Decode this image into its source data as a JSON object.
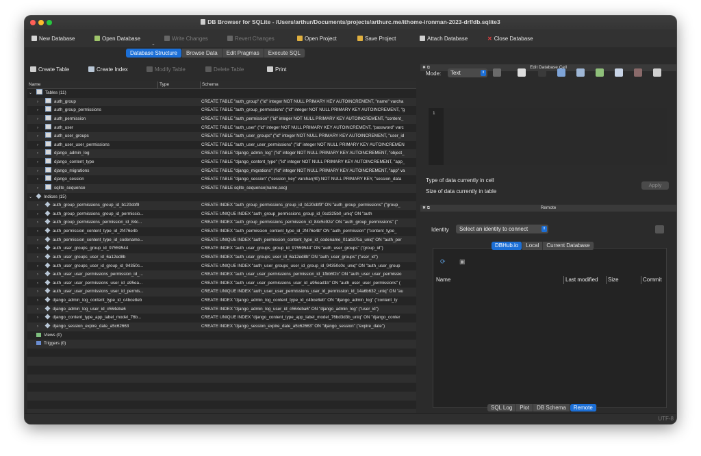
{
  "window": {
    "title": "DB Browser for SQLite - /Users/arthur/Documents/projects/arthurc.me/ithome-ironman-2023-drf/db.sqlite3"
  },
  "toolbar": {
    "new_database": "New Database",
    "open_database": "Open Database",
    "write_changes": "Write Changes",
    "revert_changes": "Revert Changes",
    "open_project": "Open Project",
    "save_project": "Save Project",
    "attach_database": "Attach Database",
    "close_database": "Close Database"
  },
  "tabs": [
    "Database Structure",
    "Browse Data",
    "Edit Pragmas",
    "Execute SQL"
  ],
  "structure_toolbar": {
    "create_table": "Create Table",
    "create_index": "Create Index",
    "modify_table": "Modify Table",
    "delete_table": "Delete Table",
    "print": "Print"
  },
  "tree": {
    "columns": {
      "name": "Name",
      "type": "Type",
      "schema": "Schema"
    },
    "tables_header": "Tables (11)",
    "tables": [
      {
        "name": "auth_group",
        "schema": "CREATE TABLE \"auth_group\" (\"id\" integer NOT NULL PRIMARY KEY AUTOINCREMENT, \"name\" varcha"
      },
      {
        "name": "auth_group_permissions",
        "schema": "CREATE TABLE \"auth_group_permissions\" (\"id\" integer NOT NULL PRIMARY KEY AUTOINCREMENT, \"g"
      },
      {
        "name": "auth_permission",
        "schema": "CREATE TABLE \"auth_permission\" (\"id\" integer NOT NULL PRIMARY KEY AUTOINCREMENT, \"content_"
      },
      {
        "name": "auth_user",
        "schema": "CREATE TABLE \"auth_user\" (\"id\" integer NOT NULL PRIMARY KEY AUTOINCREMENT, \"password\" varc"
      },
      {
        "name": "auth_user_groups",
        "schema": "CREATE TABLE \"auth_user_groups\" (\"id\" integer NOT NULL PRIMARY KEY AUTOINCREMENT, \"user_id"
      },
      {
        "name": "auth_user_user_permissions",
        "schema": "CREATE TABLE \"auth_user_user_permissions\" (\"id\" integer NOT NULL PRIMARY KEY AUTOINCREMEN"
      },
      {
        "name": "django_admin_log",
        "schema": "CREATE TABLE \"django_admin_log\" (\"id\" integer NOT NULL PRIMARY KEY AUTOINCREMENT, \"object_"
      },
      {
        "name": "django_content_type",
        "schema": "CREATE TABLE \"django_content_type\" (\"id\" integer NOT NULL PRIMARY KEY AUTOINCREMENT, \"app_"
      },
      {
        "name": "django_migrations",
        "schema": "CREATE TABLE \"django_migrations\" (\"id\" integer NOT NULL PRIMARY KEY AUTOINCREMENT, \"app\" va"
      },
      {
        "name": "django_session",
        "schema": "CREATE TABLE \"django_session\" (\"session_key\" varchar(40) NOT NULL PRIMARY KEY, \"session_data"
      },
      {
        "name": "sqlite_sequence",
        "schema": "CREATE TABLE sqlite_sequence(name,seq)"
      }
    ],
    "indices_header": "Indices (15)",
    "indices": [
      {
        "name": "auth_group_permissions_group_id_b120cbf9",
        "schema": "CREATE INDEX \"auth_group_permissions_group_id_b120cbf9\" ON \"auth_group_permissions\" (\"group_"
      },
      {
        "name": "auth_group_permissions_group_id_permissio...",
        "schema": "CREATE UNIQUE INDEX \"auth_group_permissions_group_id_0cd325b0_uniq\" ON \"auth"
      },
      {
        "name": "auth_group_permissions_permission_id_84c...",
        "schema": "CREATE INDEX \"auth_group_permissions_permission_id_84c5c92e\" ON \"auth_group_permissions\" (\""
      },
      {
        "name": "auth_permission_content_type_id_2f476e4b",
        "schema": "CREATE INDEX \"auth_permission_content_type_id_2f476e4b\" ON \"auth_permission\" (\"content_type_"
      },
      {
        "name": "auth_permission_content_type_id_codename...",
        "schema": "CREATE UNIQUE INDEX \"auth_permission_content_type_id_codename_01ab375a_uniq\" ON \"auth_per"
      },
      {
        "name": "auth_user_groups_group_id_97559544",
        "schema": "CREATE INDEX \"auth_user_groups_group_id_97559544\" ON \"auth_user_groups\" (\"group_id\")"
      },
      {
        "name": "auth_user_groups_user_id_6a12ed8b",
        "schema": "CREATE INDEX \"auth_user_groups_user_id_6a12ed8b\" ON \"auth_user_groups\" (\"user_id\")"
      },
      {
        "name": "auth_user_groups_user_id_group_id_94350c...",
        "schema": "CREATE UNIQUE INDEX \"auth_user_groups_user_id_group_id_94350c0c_uniq\" ON \"auth_user_group"
      },
      {
        "name": "auth_user_user_permissions_permission_id_...",
        "schema": "CREATE INDEX \"auth_user_user_permissions_permission_id_1fbb5f2c\" ON \"auth_user_user_permissio"
      },
      {
        "name": "auth_user_user_permissions_user_id_a95ea...",
        "schema": "CREATE INDEX \"auth_user_user_permissions_user_id_a95ead1b\" ON \"auth_user_user_permissions\" ("
      },
      {
        "name": "auth_user_user_permissions_user_id_permis...",
        "schema": "CREATE UNIQUE INDEX \"auth_user_user_permissions_user_id_permission_id_14a6b632_uniq\" ON \"au"
      },
      {
        "name": "django_admin_log_content_type_id_c4bce8eb",
        "schema": "CREATE INDEX \"django_admin_log_content_type_id_c4bce8eb\" ON \"django_admin_log\" (\"content_ty"
      },
      {
        "name": "django_admin_log_user_id_c564eba6",
        "schema": "CREATE INDEX \"django_admin_log_user_id_c564eba6\" ON \"django_admin_log\" (\"user_id\")"
      },
      {
        "name": "django_content_type_app_label_model_76b...",
        "schema": "CREATE UNIQUE INDEX \"django_content_type_app_label_model_76bd3d3b_uniq\" ON \"django_conter"
      },
      {
        "name": "django_session_expire_date_a5c62663",
        "schema": "CREATE INDEX \"django_session_expire_date_a5c62663\" ON \"django_session\" (\"expire_date\")"
      }
    ],
    "views_header": "Views (0)",
    "triggers_header": "Triggers (0)"
  },
  "edit_cell": {
    "title": "Edit Database Cell",
    "mode_label": "Mode:",
    "mode_value": "Text",
    "line_number": "1",
    "type_label": "Type of data currently in cell",
    "size_label": "Size of data currently in table",
    "apply": "Apply"
  },
  "remote": {
    "title": "Remote",
    "identity_label": "Identity",
    "identity_placeholder": "Select an identity to connect",
    "tabs": [
      "DBHub.io",
      "Local",
      "Current Database"
    ],
    "columns": [
      "Name",
      "Last modified",
      "Size",
      "Commit"
    ]
  },
  "bottom_tabs": [
    "SQL Log",
    "Plot",
    "DB Schema",
    "Remote"
  ],
  "status": {
    "encoding": "UTF-8"
  },
  "colors": {
    "accent": "#1c6fd6",
    "background": "#2b2b2b"
  }
}
